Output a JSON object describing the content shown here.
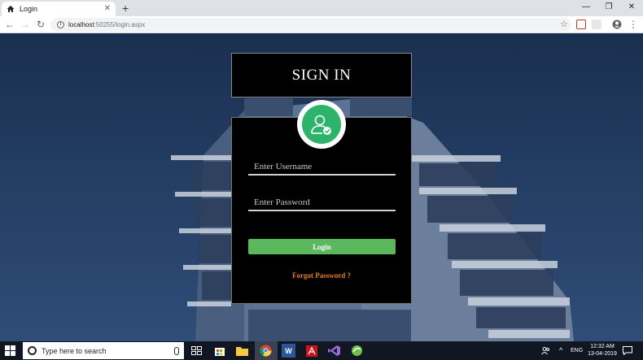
{
  "browser": {
    "tab_title": "Login",
    "tab_close": "✕",
    "new_tab": "+",
    "window_controls": [
      "—",
      "❐",
      "✕"
    ],
    "nav_back": "←",
    "nav_forward": "→",
    "nav_reload": "↻",
    "url_host": "localhost",
    "url_rest": ":50255/login.aspx",
    "star": "☆"
  },
  "login": {
    "title": "SIGN IN",
    "username_placeholder": "Enter Username",
    "password_placeholder": "Enter Password",
    "login_label": "Login",
    "forgot_label": "Forgot Password ?"
  },
  "colors": {
    "login_button": "#5cb85c",
    "avatar": "#2db36a",
    "forgot_link": "#e67e22"
  },
  "taskbar": {
    "search_placeholder": "Type here to search",
    "tray_lang": "ENG",
    "time": "12:32 AM",
    "date": "13-04-2019",
    "tray_arrow": "^"
  }
}
